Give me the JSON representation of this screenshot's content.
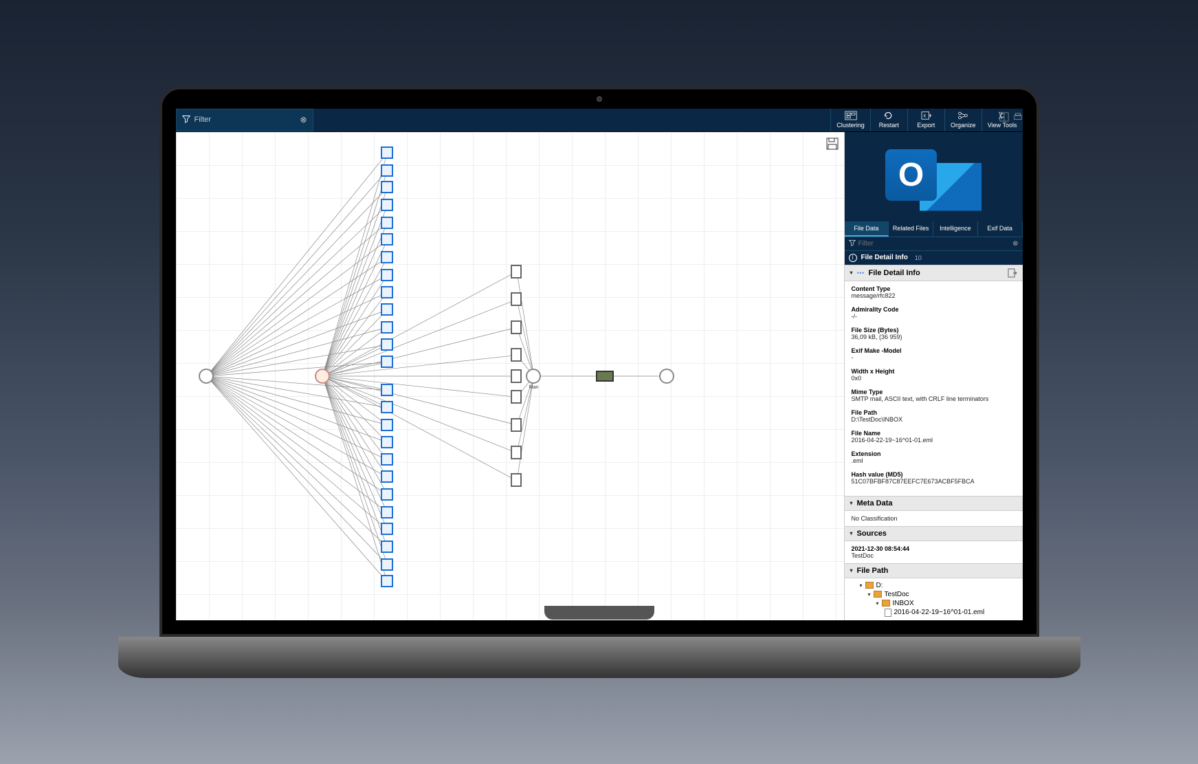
{
  "toolbar": {
    "filter_placeholder": "Filter",
    "buttons": {
      "clustering": "Clustering",
      "restart": "Restart",
      "export": "Export",
      "organize": "Organize",
      "view_tools": "View Tools"
    }
  },
  "canvas": {
    "hub_label": "",
    "man_label": "Man"
  },
  "right": {
    "tabs": [
      "File Data",
      "Related Files",
      "Intelligence",
      "Exif Data"
    ],
    "filter_placeholder": "Filter",
    "detail_header": "File Detail Info",
    "detail_count": "10",
    "sections": {
      "file_detail": {
        "title": "File Detail Info",
        "fields": {
          "content_type": {
            "label": "Content Type",
            "value": "message/rfc822"
          },
          "admirality_code": {
            "label": "Admirality Code",
            "value": "-/-"
          },
          "file_size": {
            "label": "File Size (Bytes)",
            "value": "36,09 kB, (36 959)"
          },
          "exif_make_model": {
            "label": "Exif Make -Model",
            "value": "-"
          },
          "width_height": {
            "label": "Width x Height",
            "value": "0x0"
          },
          "mime_type": {
            "label": "Mime Type",
            "value": "SMTP mail, ASCII text, with CRLF line terminators"
          },
          "file_path": {
            "label": "File Path",
            "value": "D:\\TestDoc\\INBOX"
          },
          "file_name": {
            "label": "File Name",
            "value": "2016-04-22-19~16^01-01.eml"
          },
          "extension": {
            "label": "Extension",
            "value": ".eml"
          },
          "hash_md5": {
            "label": "Hash value (MD5)",
            "value": "51C07BFBF87C87EEFC7E673ACBF5FBCA"
          }
        }
      },
      "meta_data": {
        "title": "Meta Data",
        "value": "No Classification"
      },
      "sources": {
        "title": "Sources",
        "timestamp": "2021-12-30 08:54:44",
        "name": "TestDoc"
      },
      "file_path_tree": {
        "title": "File Path",
        "root": "D:",
        "level1": "TestDoc",
        "level2": "INBOX",
        "file": "2016-04-22-19~16^01-01.eml"
      }
    }
  }
}
